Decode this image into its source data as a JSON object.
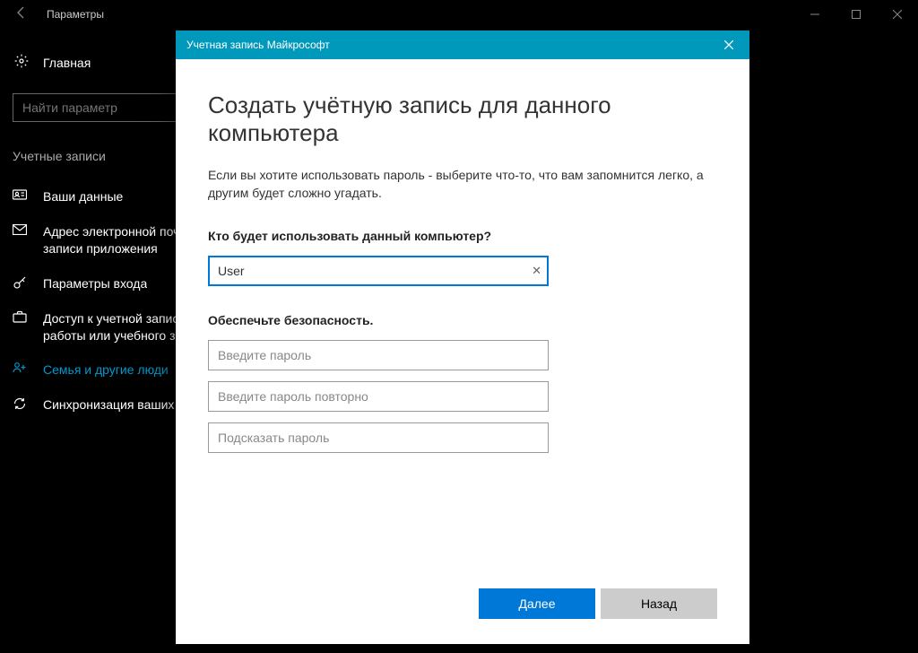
{
  "window": {
    "title": "Параметры"
  },
  "sidebar": {
    "home": "Главная",
    "search_placeholder": "Найти параметр",
    "section": "Учетные записи",
    "items": [
      {
        "label": "Ваши данные"
      },
      {
        "label": "Адрес электронной почты; учетные записи приложения"
      },
      {
        "label": "Параметры входа"
      },
      {
        "label": "Доступ к учетной записи места работы или учебного заведения"
      },
      {
        "label": "Семья и другие люди"
      },
      {
        "label": "Синхронизация ваших параметров"
      }
    ]
  },
  "dialog": {
    "titlebar": "Учетная запись Майкрософт",
    "heading": "Создать учётную запись для данного компьютера",
    "description": "Если вы хотите использовать пароль - выберите что-то, что вам запомнится легко, а другим будет сложно угадать.",
    "q1_label": "Кто будет использовать данный компьютер?",
    "username_value": "User",
    "q2_label": "Обеспечьте безопасность.",
    "pass1_placeholder": "Введите пароль",
    "pass2_placeholder": "Введите пароль повторно",
    "hint_placeholder": "Подсказать пароль",
    "next": "Далее",
    "back": "Назад"
  }
}
